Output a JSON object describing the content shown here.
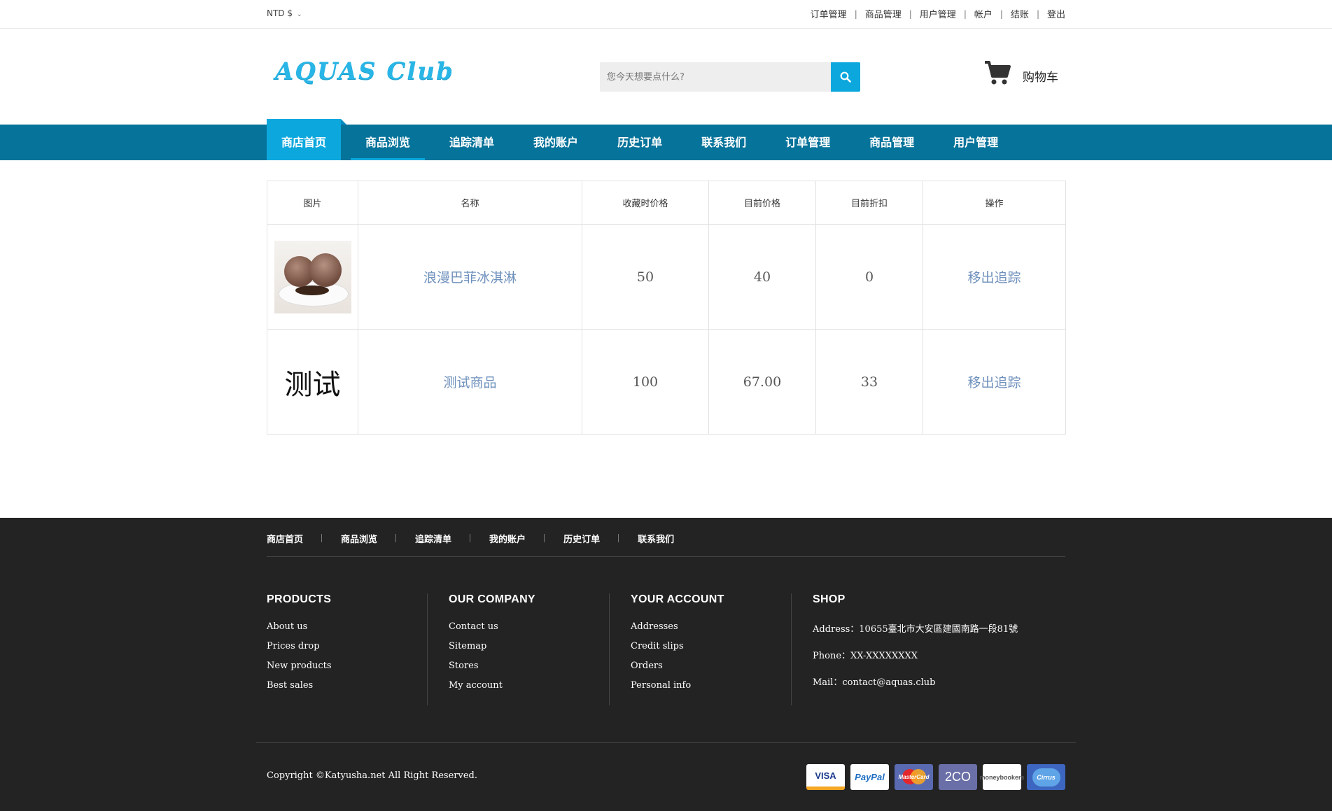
{
  "topbar": {
    "currency": "NTD $",
    "links": [
      "订单管理",
      "商品管理",
      "用户管理",
      "帐户",
      "结账",
      "登出"
    ]
  },
  "header": {
    "logo": "AQUAS Club",
    "search_placeholder": "您今天想要点什么?",
    "cart_label": "购物车"
  },
  "nav": {
    "items": [
      "商店首页",
      "商品浏览",
      "追踪清单",
      "我的账户",
      "历史订单",
      "联系我们",
      "订单管理",
      "商品管理",
      "用户管理"
    ]
  },
  "table": {
    "headers": [
      "图片",
      "名称",
      "收藏时价格",
      "目前价格",
      "目前折扣",
      "操作"
    ],
    "rows": [
      {
        "image": "",
        "name": "浪漫巴菲冰淇淋",
        "fav_price": "50",
        "current_price": "40",
        "discount": "0",
        "action": "移出追踪"
      },
      {
        "image": "测试",
        "name": "测试商品",
        "fav_price": "100",
        "current_price": "67.00",
        "discount": "33",
        "action": "移出追踪"
      }
    ]
  },
  "footer": {
    "nav": [
      "商店首页",
      "商品浏览",
      "追踪清单",
      "我的账户",
      "历史订单",
      "联系我们"
    ],
    "products": {
      "title": "PRODUCTS",
      "items": [
        "About us",
        "Prices drop",
        "New products",
        "Best sales"
      ]
    },
    "company": {
      "title": "OUR COMPANY",
      "items": [
        "Contact us",
        "Sitemap",
        "Stores",
        "My account"
      ]
    },
    "account": {
      "title": "YOUR ACCOUNT",
      "items": [
        "Addresses",
        "Credit slips",
        "Orders",
        "Personal info"
      ]
    },
    "shop": {
      "title": "SHOP",
      "address": "Address：10655臺北市大安區建國南路一段81號",
      "phone": "Phone：XX-XXXXXXXX",
      "mail": "Mail：contact@aquas.club"
    },
    "copyright": "Copyright ©Katyusha.net All Right Reserved.",
    "payments": [
      "VISA",
      "PayPal",
      "MasterCard",
      "2CO",
      "moneybookers",
      "Cirrus"
    ]
  },
  "colors": {
    "nav_bg": "#06739a",
    "accent": "#0ca8dd",
    "footer_bg": "#232323",
    "link": "#6f91bd"
  }
}
